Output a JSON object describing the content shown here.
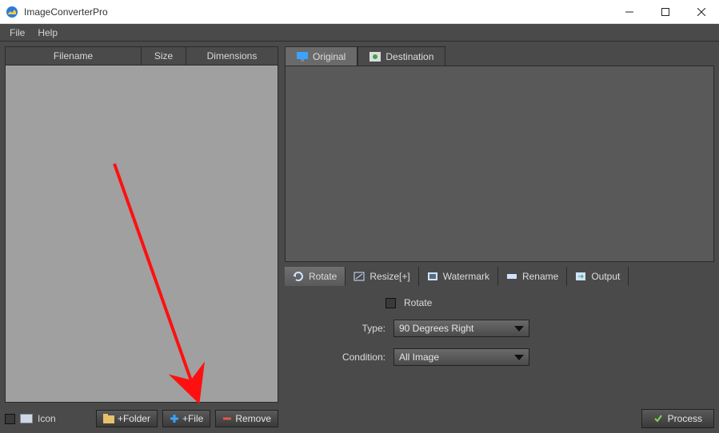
{
  "app": {
    "title": "ImageConverterPro"
  },
  "menu": {
    "file": "File",
    "help": "Help"
  },
  "table": {
    "cols": {
      "filename": "Filename",
      "size": "Size",
      "dims": "Dimensions"
    }
  },
  "left_footer": {
    "icon_label": "Icon",
    "btn_folder": "+Folder",
    "btn_file": "+File",
    "btn_remove": "Remove"
  },
  "tabs": {
    "original": "Original",
    "destination": "Destination"
  },
  "ops": {
    "rotate": "Rotate",
    "resize": "Resize[+]",
    "watermark": "Watermark",
    "rename": "Rename",
    "output": "Output"
  },
  "rotate": {
    "checkbox_label": "Rotate",
    "type_label": "Type:",
    "type_value": "90 Degrees Right",
    "cond_label": "Condition:",
    "cond_value": "All Image"
  },
  "process": {
    "label": "Process"
  }
}
